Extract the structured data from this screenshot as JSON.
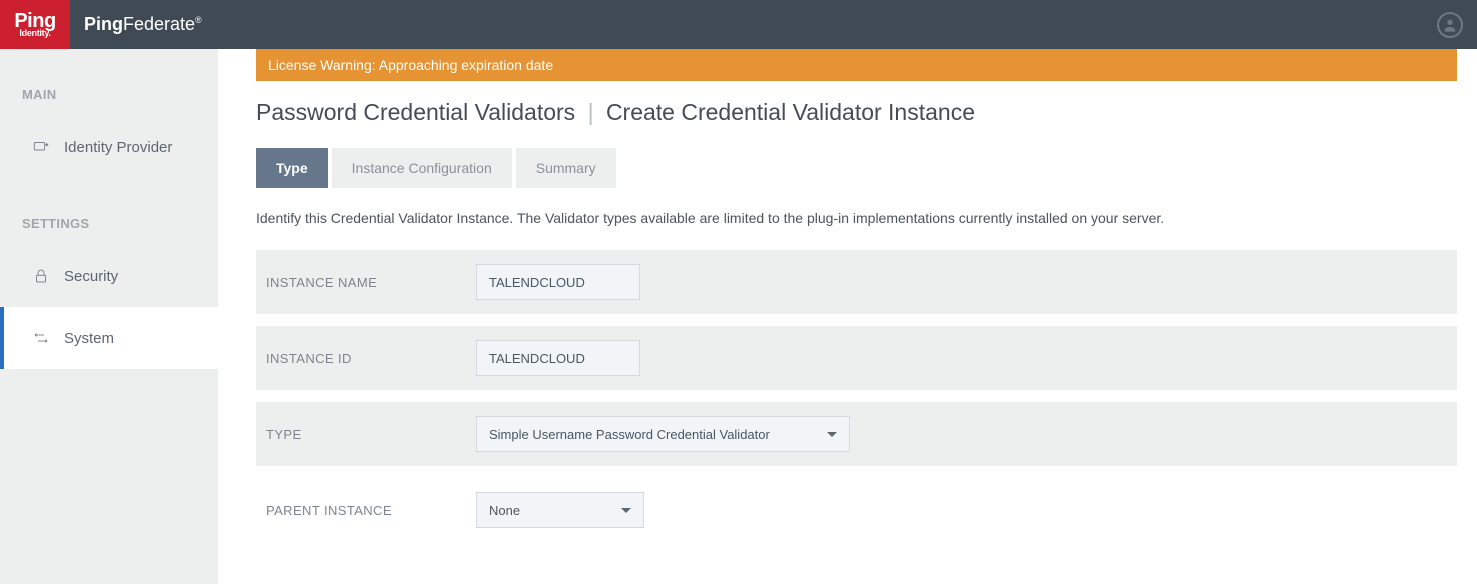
{
  "header": {
    "logo_main": "Ping",
    "logo_sub": "Identity.",
    "product": "PingFederate"
  },
  "sidebar": {
    "sections": {
      "main_label": "MAIN",
      "settings_label": "SETTINGS"
    },
    "items": {
      "identity_provider": "Identity Provider",
      "security": "Security",
      "system": "System"
    }
  },
  "warning": "License Warning: Approaching expiration date",
  "breadcrumb": {
    "a": "Password Credential Validators",
    "b": "Create Credential Validator Instance"
  },
  "tabs": {
    "type": "Type",
    "instance_config": "Instance Configuration",
    "summary": "Summary"
  },
  "description": "Identify this Credential Validator Instance. The Validator types available are limited to the plug-in implementations currently installed on your server.",
  "form": {
    "instance_name_label": "INSTANCE NAME",
    "instance_name_value": "TALENDCLOUD",
    "instance_id_label": "INSTANCE ID",
    "instance_id_value": "TALENDCLOUD",
    "type_label": "TYPE",
    "type_value": "Simple Username Password Credential Validator",
    "parent_label": "PARENT INSTANCE",
    "parent_value": "None"
  }
}
